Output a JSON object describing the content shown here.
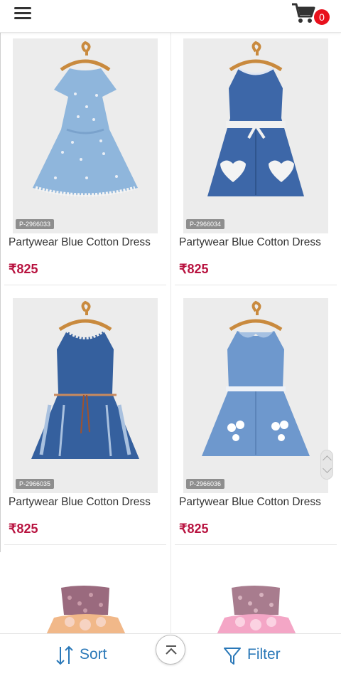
{
  "header": {
    "menu_icon": "hamburger-icon",
    "cart_icon": "cart-icon",
    "cart_count": "0"
  },
  "products": [
    {
      "code": "P-2966033",
      "title": "Partywear Blue Cotton Dress",
      "price": "₹825"
    },
    {
      "code": "P-2966034",
      "title": "Partywear Blue Cotton Dress",
      "price": "₹825"
    },
    {
      "code": "P-2966035",
      "title": "Partywear Blue Cotton Dress",
      "price": "₹825"
    },
    {
      "code": "P-2966036",
      "title": "Partywear Blue Cotton Dress",
      "price": "₹825"
    }
  ],
  "bottom_bar": {
    "sort_label": "Sort",
    "filter_label": "Filter",
    "sort_icon": "sort-arrows-icon",
    "filter_icon": "funnel-icon",
    "top_icon": "chevron-up-icon"
  },
  "colors": {
    "accent": "#2a78b8",
    "price": "#b8123f",
    "badge": "#e8101c"
  }
}
